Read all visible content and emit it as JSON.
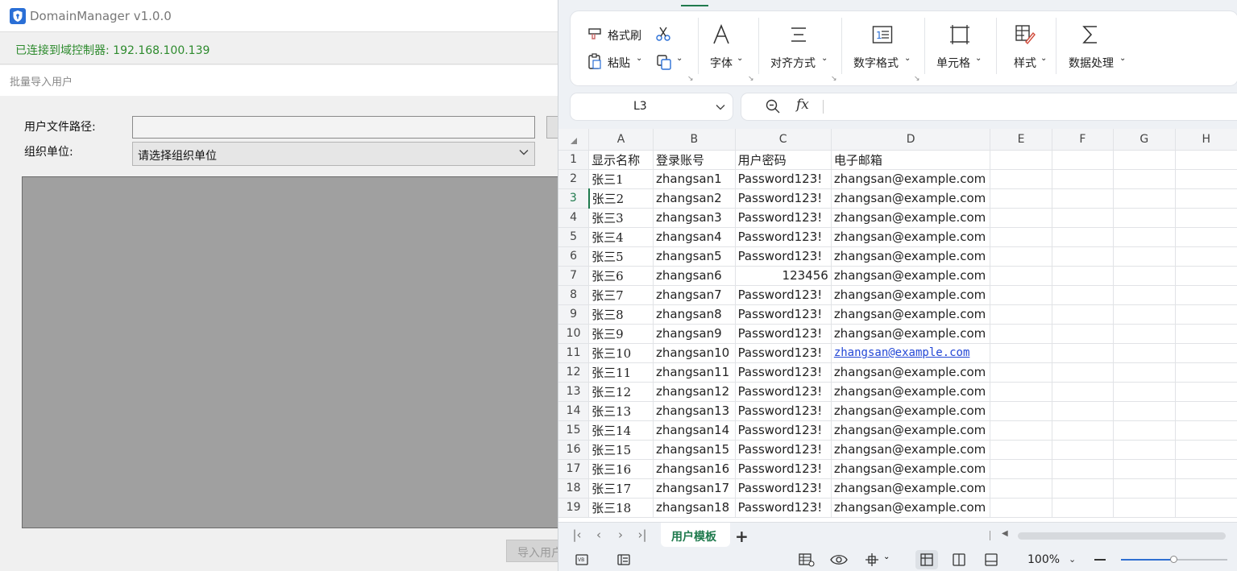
{
  "domain_manager": {
    "title": "DomainManager v1.0.0",
    "status": "已连接到域控制器: 192.168.100.139",
    "section_title": "批量导入用户",
    "path_label": "用户文件路径:",
    "path_value": "",
    "ou_label": "组织单位:",
    "ou_selected": "请选择组织单位",
    "import_button": "导入用户"
  },
  "spreadsheet": {
    "ribbon": {
      "format_painter": "格式刷",
      "paste": "粘贴",
      "font": "字体",
      "alignment": "对齐方式",
      "number_format": "数字格式",
      "cell": "单元格",
      "style": "样式",
      "data_processing": "数据处理"
    },
    "name_box": "L3",
    "formula_label": "fx",
    "formula_value": "",
    "column_headers": [
      "A",
      "B",
      "C",
      "D",
      "E",
      "F",
      "G",
      "H"
    ],
    "active_row": 3,
    "rows": [
      {
        "n": "1",
        "cells": [
          "显示名称",
          "登录账号",
          "用户密码",
          "电子邮箱"
        ]
      },
      {
        "n": "2",
        "cells": [
          "张三1",
          "zhangsan1",
          "Password123!",
          "zhangsan@example.com"
        ]
      },
      {
        "n": "3",
        "cells": [
          "张三2",
          "zhangsan2",
          "Password123!",
          "zhangsan@example.com"
        ]
      },
      {
        "n": "4",
        "cells": [
          "张三3",
          "zhangsan3",
          "Password123!",
          "zhangsan@example.com"
        ]
      },
      {
        "n": "5",
        "cells": [
          "张三4",
          "zhangsan4",
          "Password123!",
          "zhangsan@example.com"
        ]
      },
      {
        "n": "6",
        "cells": [
          "张三5",
          "zhangsan5",
          "Password123!",
          "zhangsan@example.com"
        ]
      },
      {
        "n": "7",
        "cells": [
          "张三6",
          "zhangsan6",
          "123456",
          "zhangsan@example.com"
        ]
      },
      {
        "n": "8",
        "cells": [
          "张三7",
          "zhangsan7",
          "Password123!",
          "zhangsan@example.com"
        ]
      },
      {
        "n": "9",
        "cells": [
          "张三8",
          "zhangsan8",
          "Password123!",
          "zhangsan@example.com"
        ]
      },
      {
        "n": "10",
        "cells": [
          "张三9",
          "zhangsan9",
          "Password123!",
          "zhangsan@example.com"
        ]
      },
      {
        "n": "11",
        "cells": [
          "张三10",
          "zhangsan10",
          "Password123!",
          "zhangsan@example.com"
        ]
      },
      {
        "n": "12",
        "cells": [
          "张三11",
          "zhangsan11",
          "Password123!",
          "zhangsan@example.com"
        ]
      },
      {
        "n": "13",
        "cells": [
          "张三12",
          "zhangsan12",
          "Password123!",
          "zhangsan@example.com"
        ]
      },
      {
        "n": "14",
        "cells": [
          "张三13",
          "zhangsan13",
          "Password123!",
          "zhangsan@example.com"
        ]
      },
      {
        "n": "15",
        "cells": [
          "张三14",
          "zhangsan14",
          "Password123!",
          "zhangsan@example.com"
        ]
      },
      {
        "n": "16",
        "cells": [
          "张三15",
          "zhangsan15",
          "Password123!",
          "zhangsan@example.com"
        ]
      },
      {
        "n": "17",
        "cells": [
          "张三16",
          "zhangsan16",
          "Password123!",
          "zhangsan@example.com"
        ]
      },
      {
        "n": "18",
        "cells": [
          "张三17",
          "zhangsan17",
          "Password123!",
          "zhangsan@example.com"
        ]
      },
      {
        "n": "19",
        "cells": [
          "张三18",
          "zhangsan18",
          "Password123!",
          "zhangsan@example.com"
        ]
      }
    ],
    "sheet_tab": "用户模板",
    "zoom": "100%",
    "zoom_fraction": 0.5,
    "colors": {
      "accent": "#1f7a4d",
      "link": "#2448d6",
      "status_green": "#2e8b2e"
    }
  }
}
